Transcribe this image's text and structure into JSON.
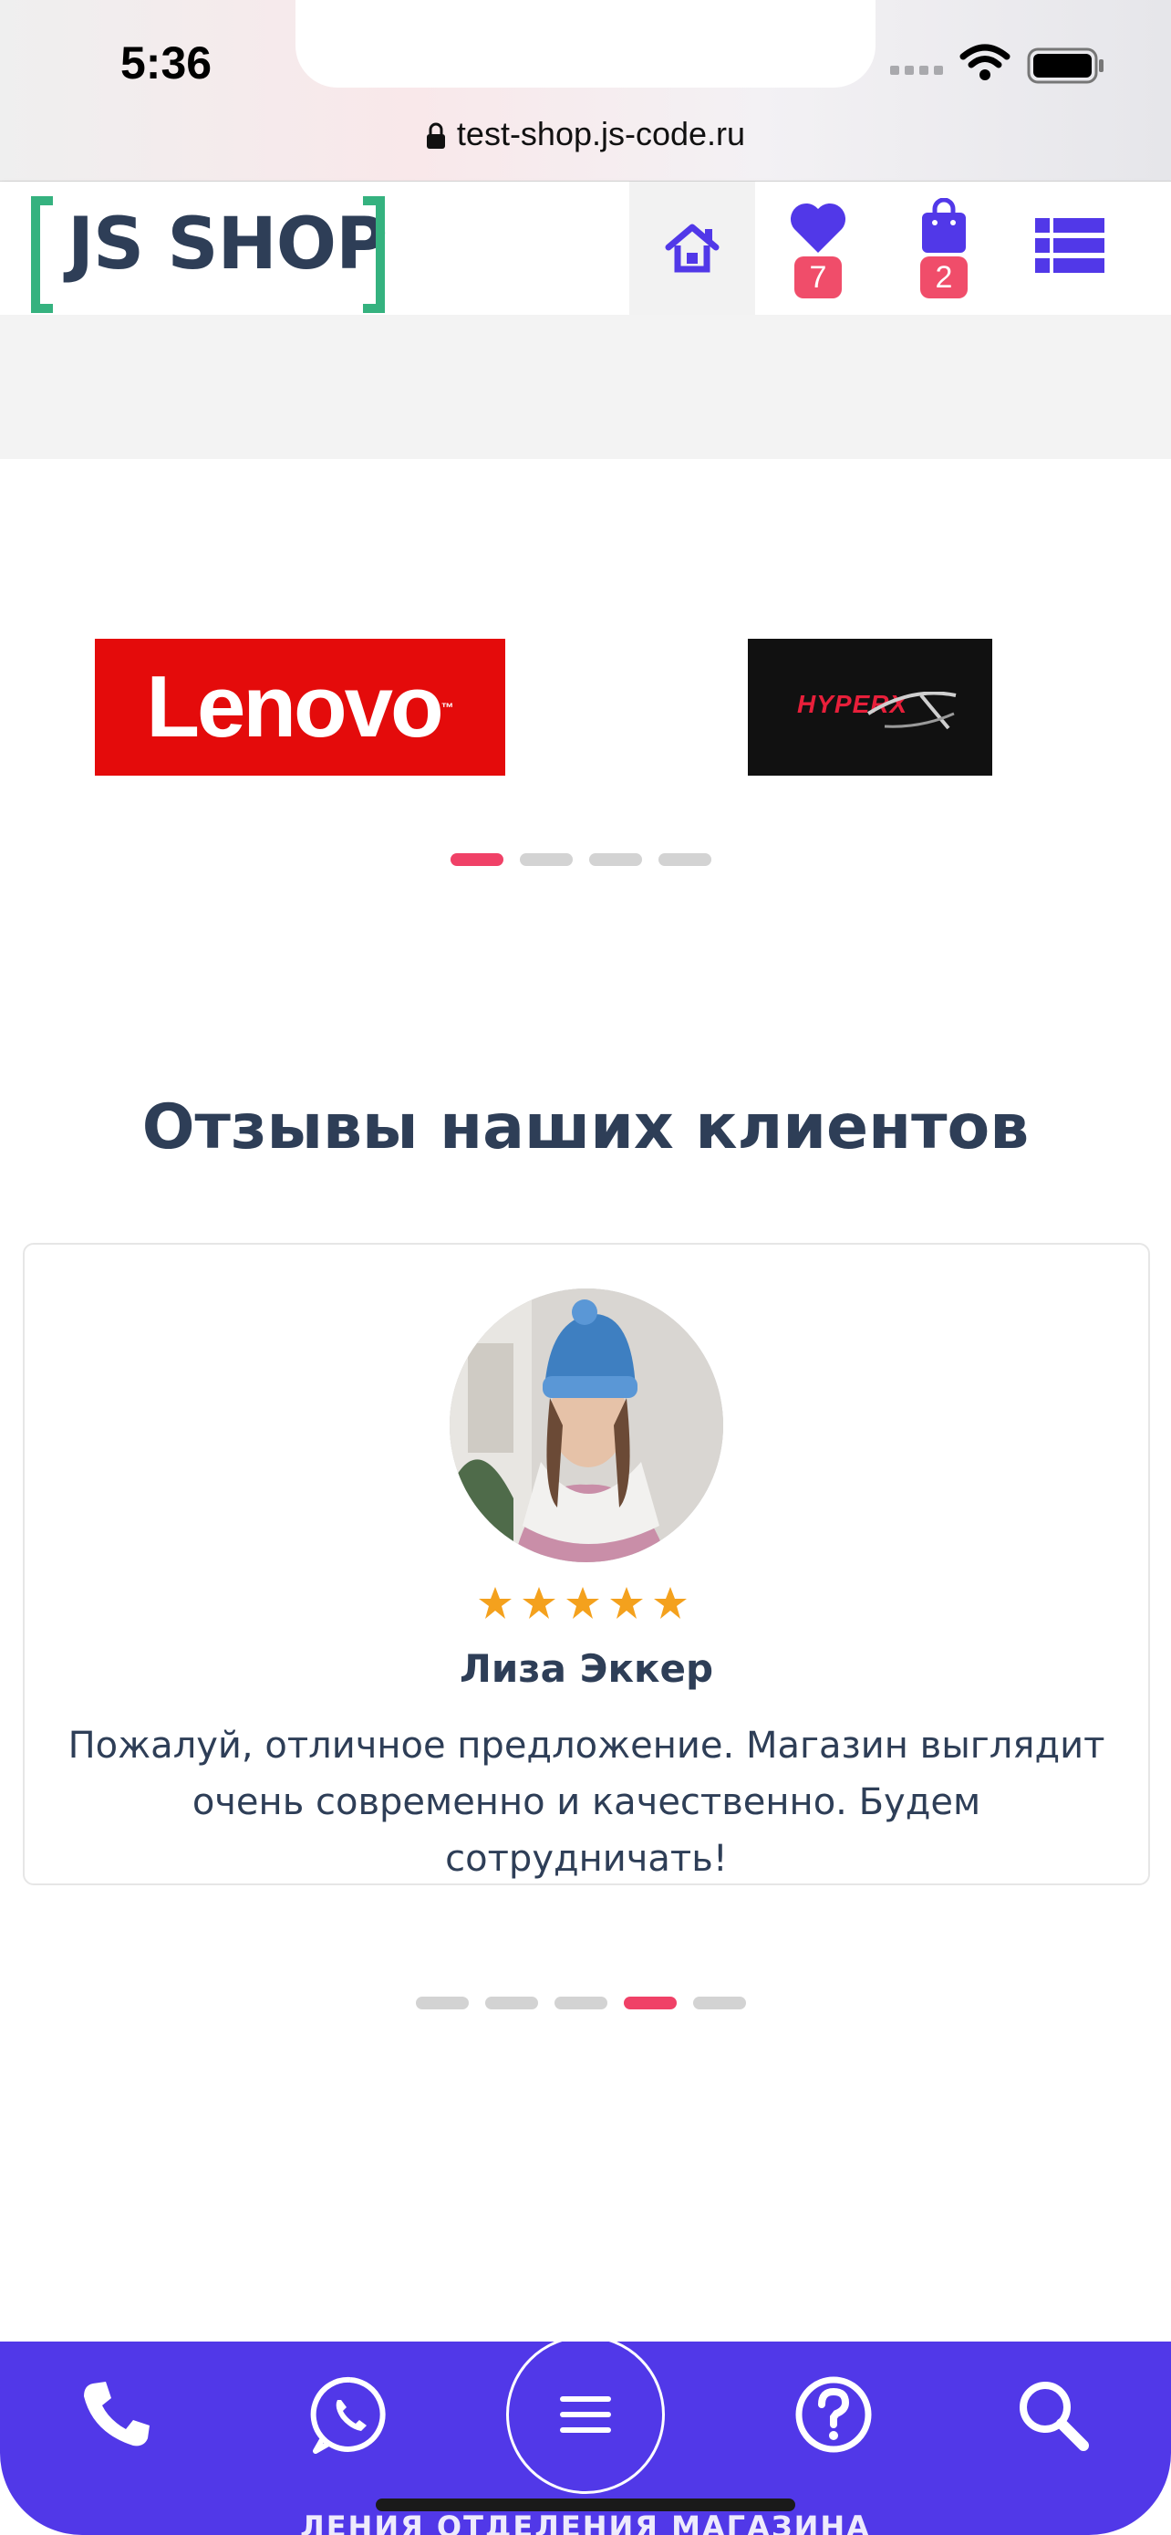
{
  "status_bar": {
    "time": "5:36",
    "url": "test-shop.js-code.ru"
  },
  "header": {
    "logo_text": "JS SHOP",
    "favorites_count": "7",
    "cart_count": "2",
    "icons": [
      "home-icon",
      "heart-icon",
      "shopping-bag-icon",
      "list-menu-icon"
    ],
    "colors": {
      "accent": "#5138e8",
      "badge": "#f04d6a",
      "logo_bracket": "#35b27f"
    }
  },
  "brands": {
    "items": [
      "Lenovo",
      "HYPERX"
    ],
    "lenovo_tm": "™",
    "pagination": {
      "total": 4,
      "active": 1
    }
  },
  "reviews": {
    "title": "Отзывы наших клиентов",
    "card": {
      "rating": 5,
      "name": "Лиза Эккер",
      "text": "Пожалуй, отличное предложение. Магазин выглядит очень современно и качественно. Будем сотрудничать!"
    },
    "pagination": {
      "total": 5,
      "active": 4
    }
  },
  "bottom_bar": {
    "icons": [
      "phone-icon",
      "whatsapp-icon",
      "menu-icon",
      "help-icon",
      "search-icon"
    ],
    "partial_text": "ЛЕНИЯ ОТДЕЛЕНИЯ МАГАЗИНА"
  }
}
